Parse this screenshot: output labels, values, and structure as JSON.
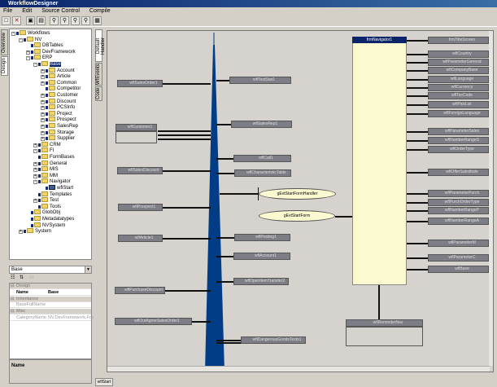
{
  "window": {
    "title": "WorkflowDesigner"
  },
  "menu": [
    "File",
    "Edit",
    "Source Control",
    "Compile"
  ],
  "left_tabs": [
    "Overview",
    "Design"
  ],
  "tree": [
    {
      "label": "Workflows",
      "level": 0,
      "pm": "-"
    },
    {
      "label": "NV",
      "level": 1,
      "pm": "-"
    },
    {
      "label": "DBTables",
      "level": 2,
      "pm": ""
    },
    {
      "label": "DevFramework",
      "level": 2,
      "pm": "+"
    },
    {
      "label": "ERP",
      "level": 2,
      "pm": "-"
    },
    {
      "label": "Base",
      "level": 3,
      "pm": "-",
      "selected": true
    },
    {
      "label": "Account",
      "level": 4,
      "pm": "+"
    },
    {
      "label": "Article",
      "level": 4,
      "pm": "+"
    },
    {
      "label": "Common",
      "level": 4,
      "pm": "+"
    },
    {
      "label": "Competitor",
      "level": 4,
      "pm": ""
    },
    {
      "label": "Customer",
      "level": 4,
      "pm": "+"
    },
    {
      "label": "Discount",
      "level": 4,
      "pm": "+"
    },
    {
      "label": "PCSInfo",
      "level": 4,
      "pm": "+"
    },
    {
      "label": "Project",
      "level": 4,
      "pm": "+"
    },
    {
      "label": "Prospect",
      "level": 4,
      "pm": "+"
    },
    {
      "label": "SalesRep",
      "level": 4,
      "pm": "+"
    },
    {
      "label": "Storage",
      "level": 4,
      "pm": "+"
    },
    {
      "label": "Supplier",
      "level": 4,
      "pm": "+"
    },
    {
      "label": "CRM",
      "level": 3,
      "pm": "+"
    },
    {
      "label": "FI",
      "level": 3,
      "pm": "-"
    },
    {
      "label": "FormBases",
      "level": 3,
      "pm": ""
    },
    {
      "label": "General",
      "level": 3,
      "pm": "+"
    },
    {
      "label": "MIS",
      "level": 3,
      "pm": "+"
    },
    {
      "label": "MM",
      "level": 3,
      "pm": "+"
    },
    {
      "label": "Navigator",
      "level": 3,
      "pm": "-"
    },
    {
      "label": "wflStart",
      "level": 4,
      "pm": "",
      "workflow": true
    },
    {
      "label": "Templates",
      "level": 3,
      "pm": ""
    },
    {
      "label": "Test",
      "level": 3,
      "pm": "+"
    },
    {
      "label": "Tools",
      "level": 3,
      "pm": ""
    },
    {
      "label": "GlobObj",
      "level": 2,
      "pm": ""
    },
    {
      "label": "Metadatatypes",
      "level": 2,
      "pm": ""
    },
    {
      "label": "NVSystem",
      "level": 2,
      "pm": ""
    },
    {
      "label": "System",
      "level": 1,
      "pm": "+"
    }
  ],
  "object_combo": {
    "value": "Base"
  },
  "properties": [
    {
      "category": "Design"
    },
    {
      "key": "Name",
      "value": "Base",
      "bold": true
    },
    {
      "category": "Inheritance"
    },
    {
      "key": "BaseFullName",
      "value": ""
    },
    {
      "category": "Misc"
    },
    {
      "key": "CategoryName",
      "value": "NV.DevFramework.Fra"
    }
  ],
  "description": {
    "title": "Name"
  },
  "designer_tabs": [
    "Default Handler",
    "WfEvents",
    "Code"
  ],
  "canvas": {
    "left_nodes": [
      "wflSalesOrder1",
      "wflCustomer1",
      "wflSalesDiscount",
      "wflProspect1",
      "wflArticle1",
      "wflPurchaseDiscount",
      "wflOutAgreeSalesOrder1"
    ],
    "mid_nodes": [
      "wflTestStat1",
      "wflSalesRep1",
      "wflCall1",
      "wflCharacteristicTable",
      "wflPosting1",
      "wflAccount1",
      "wflOpenItemTransfer2",
      "wflDangerousGoodsTexts1"
    ],
    "events": [
      "gEvtStartFormHandler",
      "gEvtStartForm"
    ],
    "navigator": "frmNavigator1",
    "right_nodes": [
      "frmTitleScreen",
      "wflCountry",
      "wflParameterGeneral",
      "wflCompanyBase",
      "wflLanguage",
      "wflCurrency",
      "wflTaxCode",
      "wflPickList",
      "wflForeignLanguage",
      "wflParameterSales",
      "wflNumberRangeS",
      "wflOrderType",
      "wflOfferSubstitute",
      "wflParameterPurch",
      "wflPurchOrderType",
      "wflNumberRangeP",
      "wflNumberRangeA",
      "wflParameterM",
      "wflParameterC",
      "wflBase"
    ],
    "reminder": "wflReminderNav"
  },
  "bottom_tab": "wflStart",
  "colors": {
    "spindle": "#003d86",
    "navigator": "#fbf9d0",
    "node": "#7d7d85"
  }
}
